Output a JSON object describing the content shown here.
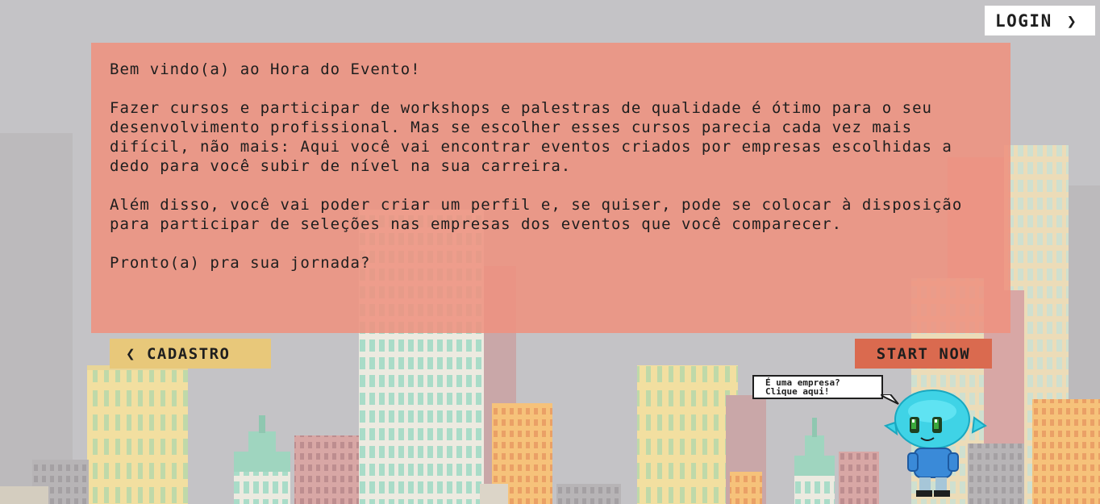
{
  "header": {
    "login_label": "LOGIN",
    "login_icon": "chevron-right-icon"
  },
  "welcome": {
    "greeting": "Bem vindo(a) ao Hora do Evento!",
    "paragraph_1": "Fazer cursos e participar de workshops e palestras de qualidade é ótimo para o seu desenvolvimento profissional. Mas se escolher esses cursos parecia cada vez mais difícil, não mais: Aqui você vai encontrar eventos criados por empresas escolhidas a dedo para você subir de nível na sua carreira.",
    "paragraph_2": "Além disso, você vai poder criar um perfil e, se quiser, pode se colocar à disposição para participar de seleções nas empresas dos eventos que você comparecer.",
    "closing": "Pronto(a) pra sua jornada?"
  },
  "actions": {
    "cadastro_label": "CADASTRO",
    "cadastro_icon": "chevron-left-icon",
    "start_label": "START NOW"
  },
  "mascot": {
    "bubble_line_1": "É uma empresa?",
    "bubble_line_2": "Clique aqui!",
    "icon": "alien-mascot-icon"
  },
  "colors": {
    "background": "#c4c3c6",
    "panel": "#ee9280",
    "cadastro_button": "#e8c87a",
    "start_button": "#da6a4f",
    "login_button": "#ffffff",
    "text": "#1e1e1e"
  }
}
